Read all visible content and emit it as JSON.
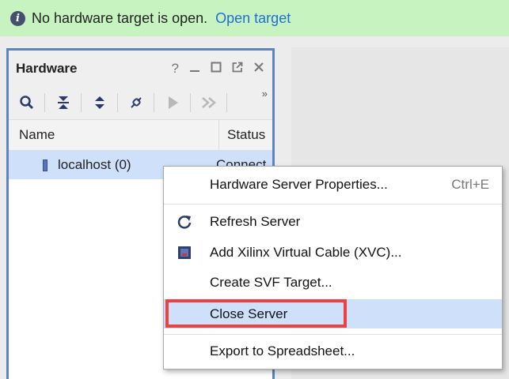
{
  "banner": {
    "message": "No hardware target is open.",
    "link": "Open target",
    "icon": "info-icon"
  },
  "panel": {
    "title": "Hardware",
    "controls": [
      "?",
      "minimize",
      "maximize",
      "float",
      "close"
    ],
    "toolbar_icons": [
      "search-icon",
      "collapse-all-icon",
      "expand-all-icon",
      "auto-connect-icon",
      "run-icon",
      "fast-forward-icon"
    ],
    "more_glyph": "»",
    "columns": [
      "Name",
      "Status"
    ],
    "rows": [
      {
        "name": "localhost (0)",
        "status": "Connect"
      }
    ]
  },
  "context_menu": {
    "items": [
      {
        "label": "Hardware Server Properties...",
        "shortcut": "Ctrl+E",
        "icon": ""
      },
      {
        "label": "Refresh Server",
        "shortcut": "",
        "icon": "refresh-icon"
      },
      {
        "label": "Add Xilinx Virtual Cable (XVC)...",
        "shortcut": "",
        "icon": "xvc-icon"
      },
      {
        "label": "Create SVF Target...",
        "shortcut": "",
        "icon": ""
      },
      {
        "label": "Close Server",
        "shortcut": "",
        "icon": "",
        "highlighted": true
      },
      {
        "label": "Export to Spreadsheet...",
        "shortcut": "",
        "icon": ""
      }
    ]
  },
  "colors": {
    "banner_bg": "#c6f3c0",
    "link": "#1f6fd6",
    "selection": "#cfe0fb",
    "panel_border": "#5b84c4",
    "annotation_box": "#ef3f3f"
  }
}
